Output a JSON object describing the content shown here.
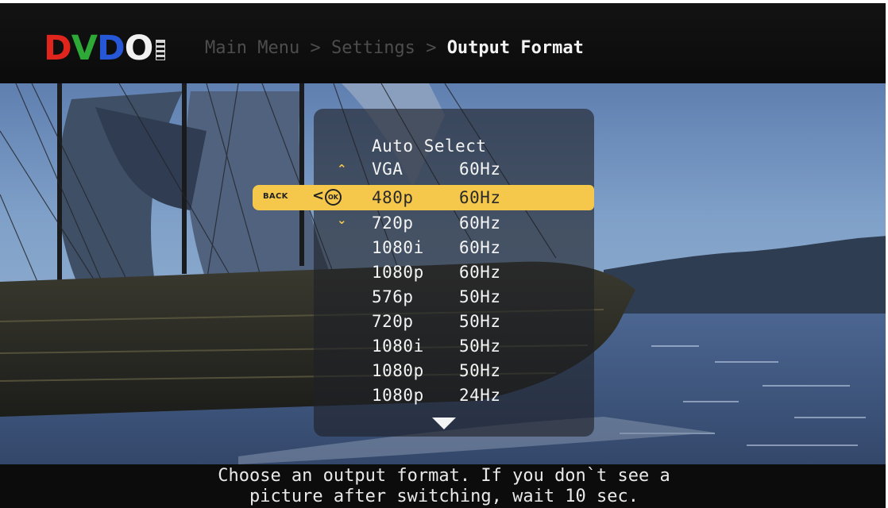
{
  "header": {
    "logo_text": "DVDO",
    "breadcrumb": [
      "Main Menu",
      "Settings",
      "Output Format"
    ],
    "separator": ">"
  },
  "menu": {
    "title_item": "Auto Select",
    "items": [
      {
        "format": "VGA",
        "rate": "60Hz"
      },
      {
        "format": "480p",
        "rate": "60Hz",
        "selected": true
      },
      {
        "format": "720p",
        "rate": "60Hz"
      },
      {
        "format": "1080i",
        "rate": "60Hz"
      },
      {
        "format": "1080p",
        "rate": "60Hz"
      },
      {
        "format": "576p",
        "rate": "50Hz"
      },
      {
        "format": "720p",
        "rate": "50Hz"
      },
      {
        "format": "1080i",
        "rate": "50Hz"
      },
      {
        "format": "1080p",
        "rate": "50Hz"
      },
      {
        "format": "1080p",
        "rate": "24Hz"
      }
    ],
    "back_label": "BACK",
    "ok_label": "OK",
    "icons": [
      "chevron-up-icon",
      "chevron-down-icon",
      "back-arrow-icon",
      "ok-icon",
      "more-down-icon"
    ]
  },
  "help": {
    "line1": "Choose an output format. If you don`t see a",
    "line2": "picture after switching, wait 10 sec."
  },
  "colors": {
    "highlight": "#f5c84c",
    "logo_d": "#e0261c",
    "logo_v": "#2ea836",
    "logo_d2": "#2557d6",
    "text_dim": "#4d4d4d",
    "text_bright": "#f2f2f2"
  }
}
